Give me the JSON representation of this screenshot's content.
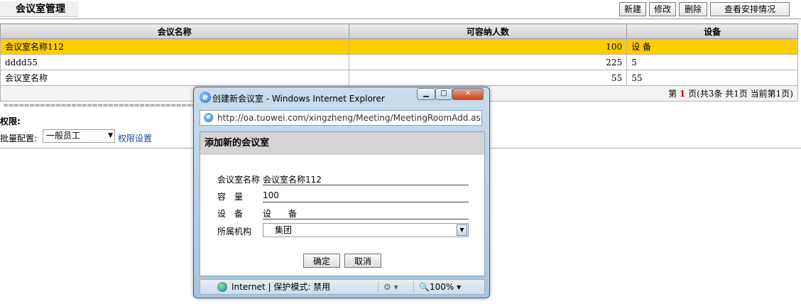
{
  "header": {
    "title": "会议室管理",
    "buttons": {
      "new": "新建",
      "edit": "修改",
      "delete": "删除",
      "schedule": "查看安排情况"
    }
  },
  "table": {
    "columns": [
      "会议名称",
      "可容纳人数",
      "设备"
    ],
    "rows": [
      {
        "name": "会议室名称112",
        "capacity": "100",
        "equipment": "设 备",
        "selected": true
      },
      {
        "name": "dddd55",
        "capacity": "225",
        "equipment": "5"
      },
      {
        "name": "会议室名称",
        "capacity": "55",
        "equipment": "55"
      }
    ],
    "pager": {
      "prefix": "第 ",
      "current": "1",
      "suffix": " 页(共3条 共1页 当前第1页)"
    }
  },
  "divider_text": "====================================================================",
  "permission": {
    "label": "权限:",
    "batch_label": "批量配置:",
    "batch_value": "一般员工",
    "settings_link": "权限设置"
  },
  "dialog": {
    "window_title": "创建新会议室 - Windows Internet Explorer",
    "address": "http://oa.tuowei.com/xingzheng/Meeting/MeetingRoomAdd.asp",
    "heading": "添加新的会议室",
    "fields": {
      "name_label": "会议室名称",
      "name_value": "会议室名称112",
      "capacity_label": "容　量",
      "capacity_value": "100",
      "equipment_label": "设　备",
      "equipment_value": "设　　备",
      "org_label": "所属机构",
      "org_value": "集团"
    },
    "ok_label": "确定",
    "cancel_label": "取消",
    "status": {
      "zone": "Internet | 保护模式: 禁用",
      "zoom": "100%"
    }
  }
}
